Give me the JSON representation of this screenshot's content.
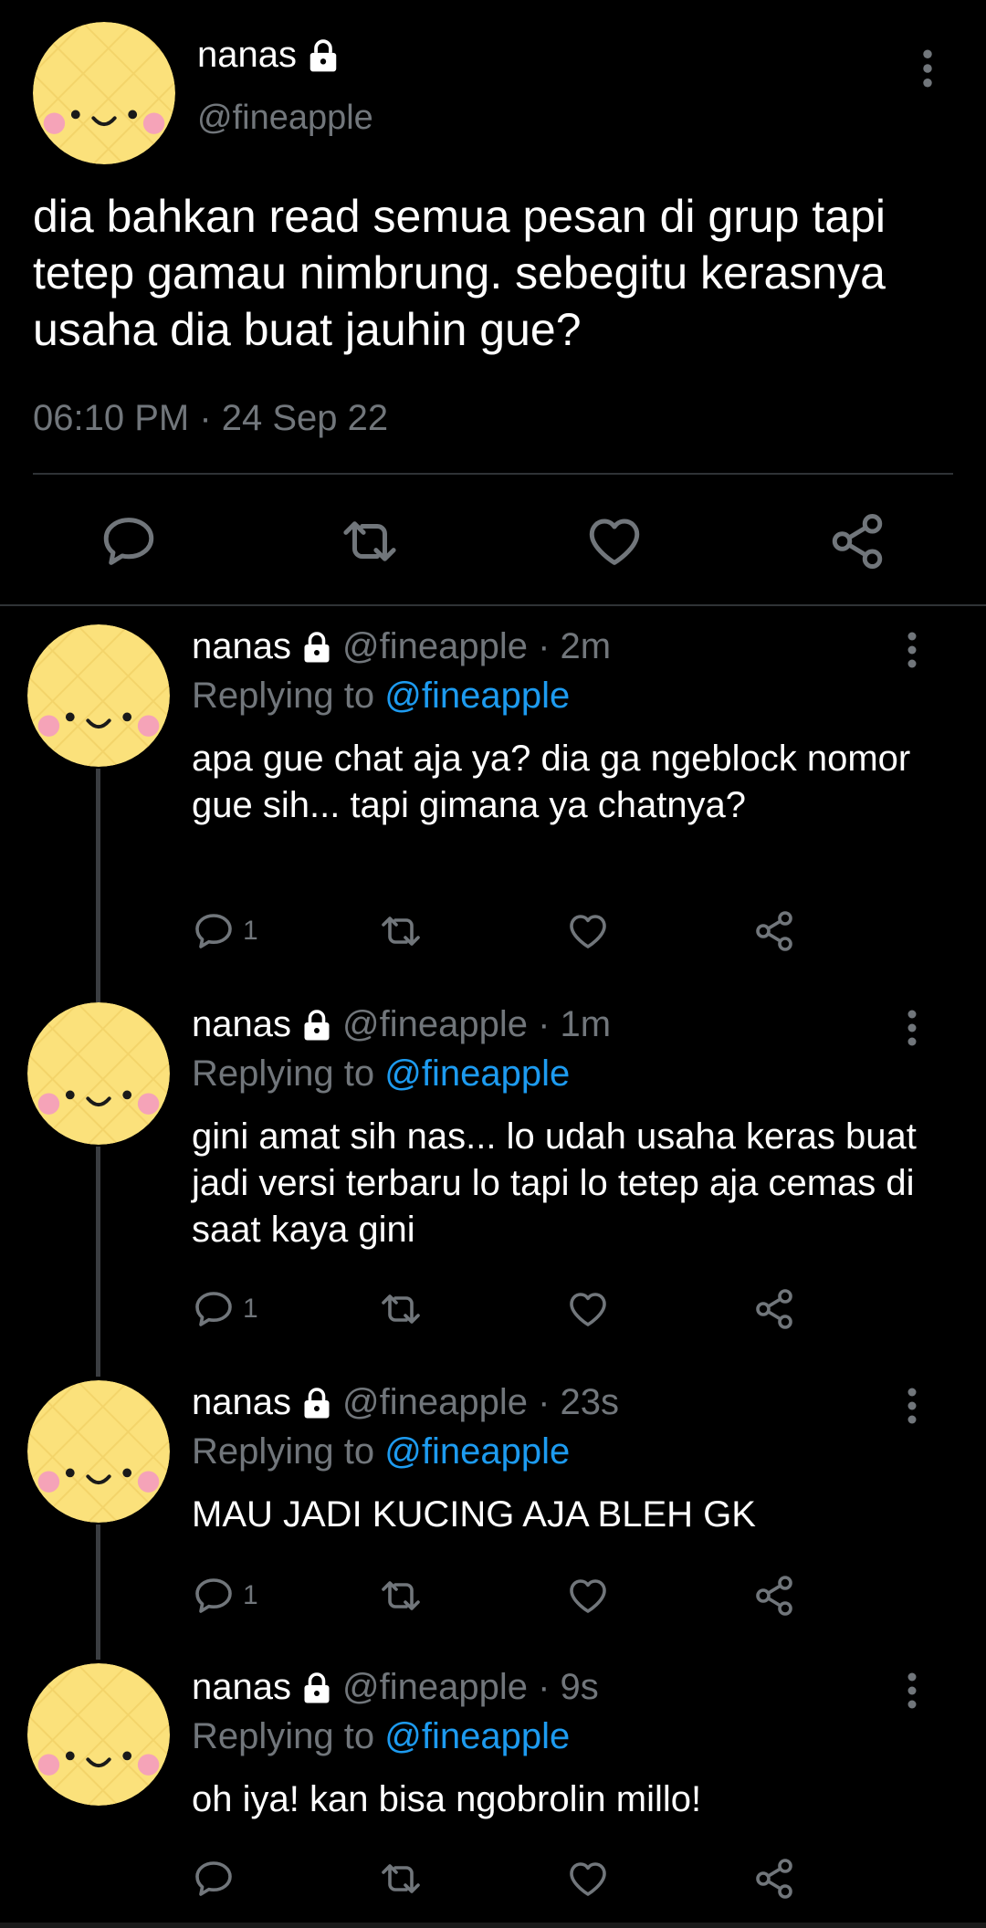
{
  "main": {
    "name": "nanas",
    "handle": "@fineapple",
    "text": "dia bahkan read semua pesan di grup tapi tetep gamau nimbrung. sebegitu kerasnya usaha dia buat jauhin gue?",
    "timestamp": "06:10 PM · 24 Sep 22"
  },
  "replies": [
    {
      "name": "nanas",
      "handle": "@fineapple · 2m",
      "replying_label": "Replying to",
      "mention": "@fineapple",
      "text": "apa gue chat aja ya? dia ga ngeblock nomor gue sih... tapi gimana ya chatnya?",
      "reply_count": "1"
    },
    {
      "name": "nanas",
      "handle": "@fineapple · 1m",
      "replying_label": "Replying to",
      "mention": "@fineapple",
      "text": "gini amat sih nas... lo udah usaha keras buat jadi versi terbaru lo tapi lo tetep aja cemas di saat kaya gini",
      "reply_count": "1"
    },
    {
      "name": "nanas",
      "handle": "@fineapple · 23s",
      "replying_label": "Replying to",
      "mention": "@fineapple",
      "text": "MAU JADI KUCING AJA BLEH GK",
      "reply_count": "1"
    },
    {
      "name": "nanas",
      "handle": "@fineapple · 9s",
      "replying_label": "Replying to",
      "mention": "@fineapple",
      "text": "oh iya! kan bisa ngobrolin millo!",
      "reply_count": ""
    }
  ],
  "icons": {
    "lock": "lock-icon",
    "reply": "reply-icon",
    "retweet": "retweet-icon",
    "like": "heart-icon",
    "share": "share-icon",
    "more": "more-vertical-icon"
  },
  "colors": {
    "background": "#000000",
    "muted": "#71767b",
    "link": "#1d9bf0",
    "avatar": "#fbe17b"
  }
}
